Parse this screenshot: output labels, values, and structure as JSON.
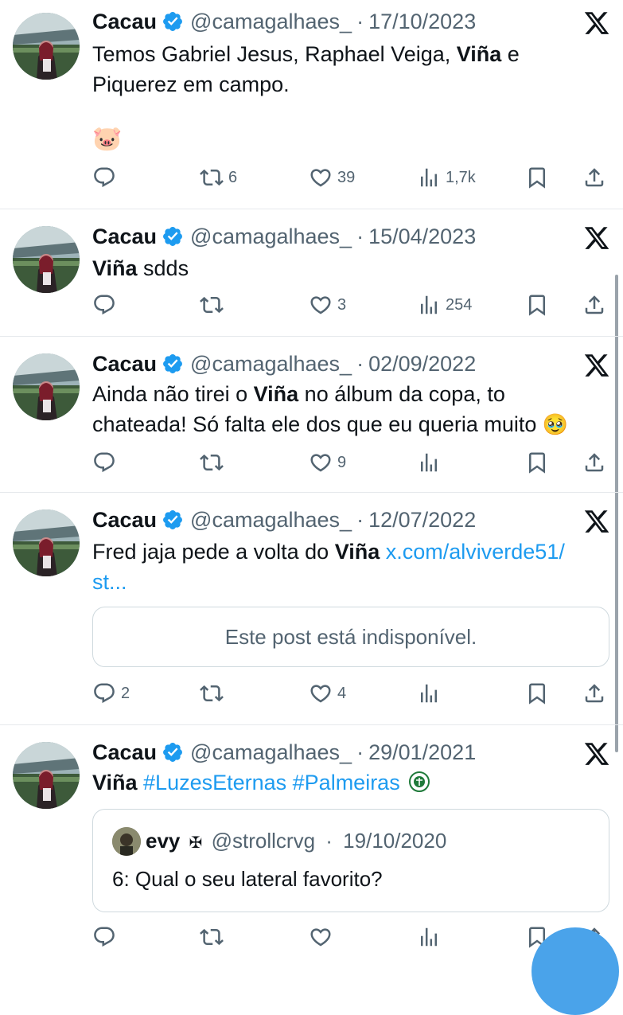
{
  "colors": {
    "accent": "#1d9bf0",
    "muted": "#536471",
    "text": "#0f1419",
    "verified": "#1d9bf0"
  },
  "icons": [
    "verified-badge-icon",
    "x-logo-icon",
    "reply-icon",
    "repost-icon",
    "like-icon",
    "views-icon",
    "bookmark-icon",
    "share-icon",
    "pig-emoji",
    "pleading-face-emoji",
    "palmeiras-crest-emoji",
    "maltese-cross-icon"
  ],
  "tweets": [
    {
      "name": "Cacau",
      "handle": "@camagalhaes_",
      "sep": "·",
      "date": "17/10/2023",
      "text_parts": [
        "Temos Gabriel Jesus, Raphael Veiga, ",
        "Viña",
        " e",
        "Piquerez em campo."
      ],
      "emoji": "🐷",
      "stats": {
        "replies": "",
        "reposts": "6",
        "likes": "39",
        "views": "1,7k"
      }
    },
    {
      "name": "Cacau",
      "handle": "@camagalhaes_",
      "sep": "·",
      "date": "15/04/2023",
      "text_parts": [
        "Viña",
        " sdds"
      ],
      "stats": {
        "replies": "",
        "reposts": "",
        "likes": "3",
        "views": "254"
      }
    },
    {
      "name": "Cacau",
      "handle": "@camagalhaes_",
      "sep": "·",
      "date": "02/09/2022",
      "text_parts": [
        "Ainda não tirei o ",
        "Viña",
        " no álbum da copa, to",
        "chateada! Só falta ele dos que eu queria muito",
        "🥹"
      ],
      "stats": {
        "replies": "",
        "reposts": "",
        "likes": "9",
        "views": ""
      }
    },
    {
      "name": "Cacau",
      "handle": "@camagalhaes_",
      "sep": "·",
      "date": "12/07/2022",
      "text_parts": [
        "Fred jaja pede a volta do ",
        "Viña",
        " x.com/alviverde51/",
        "st..."
      ],
      "unavailable": "Este post está indisponível.",
      "stats": {
        "replies": "2",
        "reposts": "",
        "likes": "4",
        "views": ""
      }
    },
    {
      "name": "Cacau",
      "handle": "@camagalhaes_",
      "sep": "·",
      "date": "29/01/2021",
      "text_parts": [
        "Viña",
        " #LuzesEternas #Palmeiras"
      ],
      "quote": {
        "name": "evy",
        "cross": "✠",
        "handle": "@strollcrvg",
        "sep": "·",
        "date": "19/10/2020",
        "text": "6: Qual o seu lateral favorito?"
      },
      "stats": {
        "replies": "",
        "reposts": "",
        "likes": "",
        "views": ""
      }
    }
  ]
}
